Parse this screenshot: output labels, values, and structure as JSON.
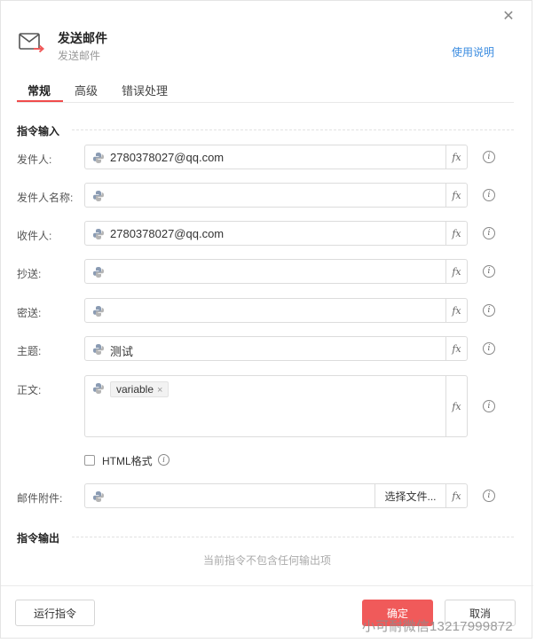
{
  "header": {
    "title": "发送邮件",
    "subtitle": "发送邮件",
    "help_link": "使用说明"
  },
  "tabs": [
    {
      "label": "常规",
      "active": true
    },
    {
      "label": "高级",
      "active": false
    },
    {
      "label": "错误处理",
      "active": false
    }
  ],
  "input_section": {
    "title": "指令输入",
    "fields": [
      {
        "label": "发件人:",
        "value": "2780378027@qq.com"
      },
      {
        "label": "发件人名称:",
        "value": ""
      },
      {
        "label": "收件人:",
        "value": "2780378027@qq.com"
      },
      {
        "label": "抄送:",
        "value": ""
      },
      {
        "label": "密送:",
        "value": ""
      },
      {
        "label": "主题:",
        "value": "测试"
      }
    ],
    "body": {
      "label": "正文:",
      "tag": "variable",
      "tag_close": "×"
    },
    "html_format": {
      "label": "HTML格式",
      "checked": false
    },
    "attachment": {
      "label": "邮件附件:",
      "value": "",
      "choose_button": "选择文件..."
    },
    "fx_label": "fx",
    "info_glyph": "i"
  },
  "output_section": {
    "title": "指令输出",
    "empty_text": "当前指令不包含任何输出项"
  },
  "footer": {
    "run_button": "运行指令",
    "ok_button": "确定",
    "cancel_button": "取消"
  },
  "watermark": "小可耐微信13217999872",
  "colors": {
    "accent": "#f05a5a",
    "link": "#3b8ce0",
    "python_blue": "#8a9bb3",
    "python_yellow": "#b5b5b5"
  },
  "icons": {
    "close": "close-icon",
    "header": "mail-send-icon",
    "field_prefix": "python-icon",
    "info": "info-icon"
  }
}
